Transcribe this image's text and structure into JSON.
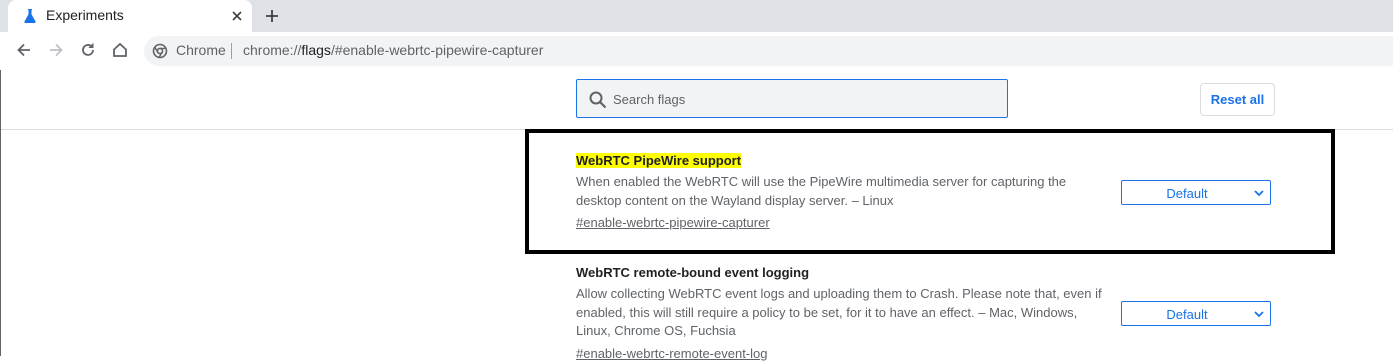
{
  "browser": {
    "tab": {
      "title": "Experiments"
    },
    "omnibox": {
      "chip": "Chrome",
      "url_scheme": "chrome://",
      "url_host": "flags",
      "url_path": "/#enable-webrtc-pipewire-capturer"
    }
  },
  "header": {
    "search_placeholder": "Search flags",
    "reset_label": "Reset all"
  },
  "experiments": [
    {
      "title": "WebRTC PipeWire support",
      "description": "When enabled the WebRTC will use the PipeWire multimedia server for capturing the desktop content on the Wayland display server. – Linux",
      "link": "#enable-webrtc-pipewire-capturer",
      "value": "Default",
      "highlighted": true
    },
    {
      "title": "WebRTC remote-bound event logging",
      "description": "Allow collecting WebRTC event logs and uploading them to Crash. Please note that, even if enabled, this will still require a policy to be set, for it to have an effect. – Mac, Windows, Linux, Chrome OS, Fuchsia",
      "link": "#enable-webrtc-remote-event-log",
      "value": "Default",
      "highlighted": false
    }
  ],
  "colors": {
    "accent": "#1a73e8",
    "highlight": "#ffff00"
  }
}
